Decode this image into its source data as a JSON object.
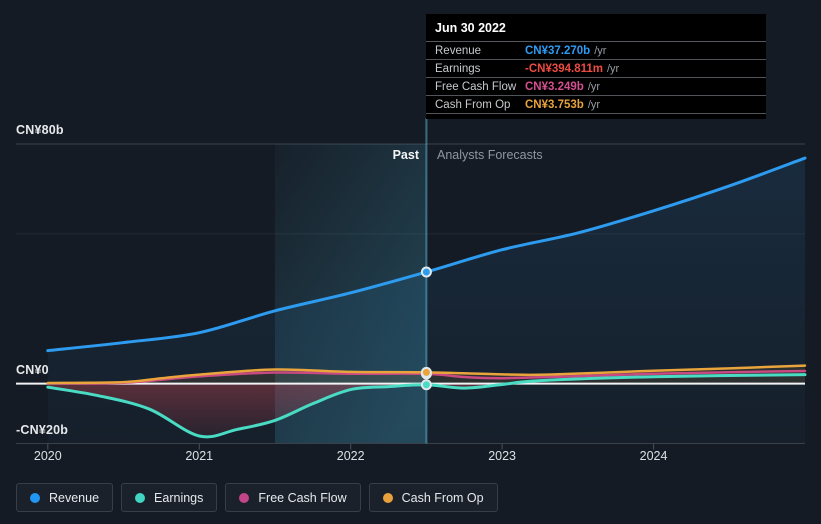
{
  "tooltip": {
    "title": "Jun 30 2022",
    "rows": [
      {
        "label": "Revenue",
        "value": "CN¥37.270b",
        "suffix": "/yr",
        "color": "#2d9cf4"
      },
      {
        "label": "Earnings",
        "value": "-CN¥394.811m",
        "suffix": "/yr",
        "color": "#ee4b43"
      },
      {
        "label": "Free Cash Flow",
        "value": "CN¥3.249b",
        "suffix": "/yr",
        "color": "#d44f90"
      },
      {
        "label": "Cash From Op",
        "value": "CN¥3.753b",
        "suffix": "/yr",
        "color": "#e8a33c"
      }
    ]
  },
  "annotations": {
    "past": "Past",
    "forecast": "Analysts Forecasts"
  },
  "axes": {
    "y_labels": [
      {
        "text": "CN¥80b",
        "value": 80
      },
      {
        "text": "CN¥0",
        "value": 0
      },
      {
        "text": "-CN¥20b",
        "value": -20
      }
    ],
    "x_labels": [
      "2020",
      "2021",
      "2022",
      "2023",
      "2024"
    ]
  },
  "legend": {
    "items": [
      {
        "label": "Revenue",
        "color": "#2196f3"
      },
      {
        "label": "Earnings",
        "color": "#41d6c1"
      },
      {
        "label": "Free Cash Flow",
        "color": "#c2458a"
      },
      {
        "label": "Cash From Op",
        "color": "#e9a23b"
      }
    ]
  },
  "chart_data": {
    "type": "line",
    "title": "Past performance and analyst forecasts (CN¥)",
    "xlim": [
      2019.79,
      2025.0
    ],
    "ylim": [
      -20,
      80
    ],
    "x_ticks": [
      2020,
      2021,
      2022,
      2023,
      2024
    ],
    "gridlines": [
      {
        "value": 80,
        "style": "strong"
      },
      {
        "value": 50,
        "style": "faint"
      },
      {
        "value": 0,
        "style": "zero"
      },
      {
        "value": -20,
        "style": "axis"
      }
    ],
    "past_band": {
      "from": 2021.5,
      "to": 2022.5
    },
    "divider_x": 2022.5,
    "series": [
      {
        "name": "Revenue",
        "color": "#2d9cf0",
        "width": 3,
        "fill": "blue",
        "x": [
          2020,
          2020.5,
          2021,
          2021.5,
          2022,
          2022.5,
          2023,
          2023.5,
          2024,
          2024.5,
          2025
        ],
        "y": [
          11,
          13.7,
          17,
          24.3,
          30.3,
          37.27,
          44.7,
          50.3,
          57.7,
          66,
          75.3
        ]
      },
      {
        "name": "Free Cash Flow",
        "color": "#c94a82",
        "width": 2.5,
        "fill": "none",
        "x": [
          2020,
          2020.5,
          2021,
          2021.5,
          2022,
          2022.5,
          2022.75,
          2023,
          2023.5,
          2024,
          2024.5,
          2025
        ],
        "y": [
          0.1,
          0.3,
          2.4,
          3.7,
          3.3,
          3.249,
          2.2,
          1.8,
          2.5,
          3.3,
          3.8,
          4.2
        ]
      },
      {
        "name": "Cash From Op",
        "color": "#e9a43c",
        "width": 2.5,
        "fill": "orange",
        "x": [
          2020,
          2020.5,
          2020.75,
          2021,
          2021.5,
          2022,
          2022.5,
          2023,
          2023.3,
          2024,
          2024.5,
          2025
        ],
        "y": [
          0.2,
          0.5,
          1.8,
          3.0,
          4.7,
          3.9,
          3.753,
          3.1,
          3.0,
          4.3,
          5.1,
          6.0
        ]
      },
      {
        "name": "Earnings",
        "color": "#49dbc3",
        "width": 3,
        "fill": "red-negative",
        "x": [
          2020,
          2020.33,
          2020.67,
          2021,
          2021.25,
          2021.5,
          2021.75,
          2022,
          2022.25,
          2022.5,
          2022.75,
          2023,
          2023.25,
          2024,
          2025
        ],
        "y": [
          -1.2,
          -4,
          -8.5,
          -17.5,
          -15.3,
          -12.3,
          -6.7,
          -2.0,
          -1.0,
          -0.395,
          -1.5,
          -0.3,
          1.0,
          2.3,
          3.0
        ]
      }
    ],
    "markers": [
      {
        "x": 2022.5,
        "y": 3.249,
        "series": "Free Cash Flow",
        "color": "#c94a82"
      },
      {
        "x": 2022.5,
        "y": 3.753,
        "series": "Cash From Op",
        "color": "#e9a43c"
      },
      {
        "x": 2022.5,
        "y": -0.395,
        "series": "Earnings",
        "color": "#49dbc3"
      },
      {
        "x": 2022.5,
        "y": 37.27,
        "series": "Revenue",
        "color": "#2d9cf0"
      }
    ]
  }
}
